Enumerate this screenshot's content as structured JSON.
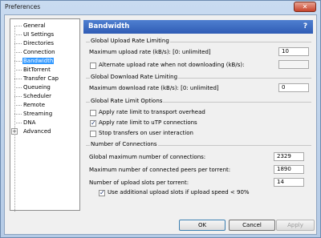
{
  "window": {
    "title": "Preferences",
    "close_icon": "close-icon"
  },
  "tree": {
    "items": [
      {
        "label": "General"
      },
      {
        "label": "UI Settings"
      },
      {
        "label": "Directories"
      },
      {
        "label": "Connection"
      },
      {
        "label": "Bandwidth",
        "selected": true
      },
      {
        "label": "BitTorrent"
      },
      {
        "label": "Transfer Cap"
      },
      {
        "label": "Queueing"
      },
      {
        "label": "Scheduler"
      },
      {
        "label": "Remote"
      },
      {
        "label": "Streaming"
      },
      {
        "label": "DNA"
      },
      {
        "label": "Advanced",
        "expander": "+"
      }
    ]
  },
  "panel": {
    "title": "Bandwidth",
    "help": "?",
    "upload": {
      "title": "Global Upload Rate Limiting",
      "max_label": "Maximum upload rate (kB/s): [0: unlimited]",
      "max_value": "10",
      "alt_label": "Alternate upload rate when not downloading (kB/s):",
      "alt_checked": false,
      "alt_value": ""
    },
    "download": {
      "title": "Global Download Rate Limiting",
      "max_label": "Maximum download rate (kB/s): [0: unlimited]",
      "max_value": "0"
    },
    "options": {
      "title": "Global Rate Limit Options",
      "items": [
        {
          "label": "Apply rate limit to transport overhead",
          "checked": false
        },
        {
          "label": "Apply rate limit to uTP connections",
          "checked": true
        },
        {
          "label": "Stop transfers on user interaction",
          "checked": false
        }
      ]
    },
    "connections": {
      "title": "Number of Connections",
      "global_label": "Global maximum number of connections:",
      "global_value": "2329",
      "peers_label": "Maximum number of connected peers per torrent:",
      "peers_value": "1890",
      "slots_label": "Number of upload slots per torrent:",
      "slots_value": "14",
      "extra_label": "Use additional upload slots if upload speed < 90%",
      "extra_checked": true
    }
  },
  "buttons": {
    "ok": "OK",
    "cancel": "Cancel",
    "apply": "Apply"
  }
}
